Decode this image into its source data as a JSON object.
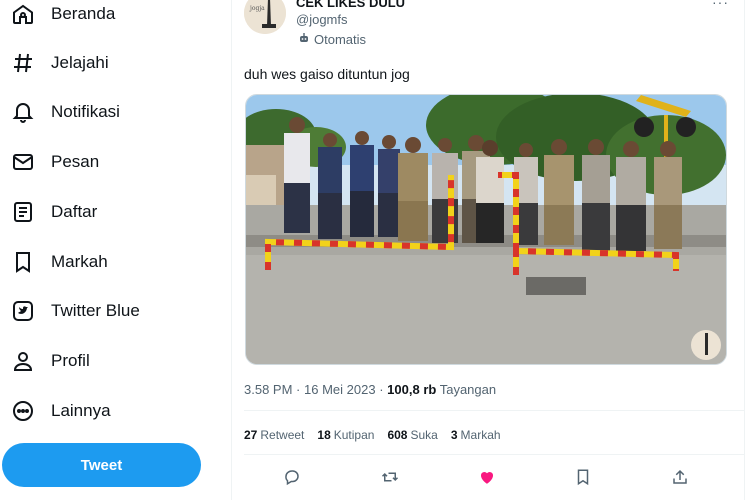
{
  "sidebar": {
    "items": [
      {
        "label": "Beranda",
        "icon": "home-icon"
      },
      {
        "label": "Jelajahi",
        "icon": "hashtag-icon"
      },
      {
        "label": "Notifikasi",
        "icon": "bell-icon"
      },
      {
        "label": "Pesan",
        "icon": "mail-icon"
      },
      {
        "label": "Daftar",
        "icon": "list-icon"
      },
      {
        "label": "Markah",
        "icon": "bookmark-icon"
      },
      {
        "label": "Twitter Blue",
        "icon": "twitter-blue-icon"
      },
      {
        "label": "Profil",
        "icon": "person-icon"
      },
      {
        "label": "Lainnya",
        "icon": "more-circle-icon"
      }
    ],
    "tweet_button": "Tweet"
  },
  "tweet": {
    "display_name": "CEK LIKES DULU",
    "handle": "@jogmfs",
    "automated_label": "Otomatis",
    "text": "duh wes gaiso dituntun jog",
    "time": "3.58 PM",
    "separator": "·",
    "date": "16 Mei 2023",
    "views_count": "100,8 rb",
    "views_label": "Tayangan",
    "stats": [
      {
        "count": "27",
        "label": "Retweet"
      },
      {
        "count": "18",
        "label": "Kutipan"
      },
      {
        "count": "608",
        "label": "Suka"
      },
      {
        "count": "3",
        "label": "Markah"
      }
    ],
    "liked": true
  },
  "colors": {
    "accent": "#1d9bf0",
    "like": "#f91880",
    "muted": "#536471"
  }
}
